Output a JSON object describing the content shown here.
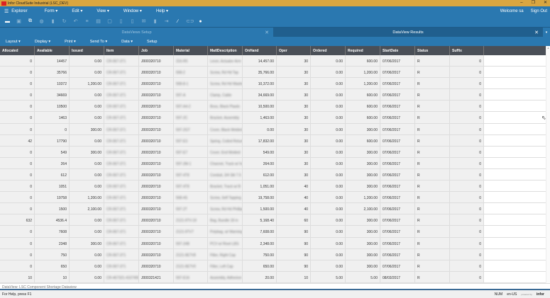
{
  "window": {
    "title": "Infor CloudSuite Industrial (LSC_DEV)",
    "minimize": "–",
    "restore": "❐",
    "close": "✕"
  },
  "menu": {
    "explorer": "Explorer",
    "items": [
      "Form ▾",
      "Edit ▾",
      "View ▾",
      "Window ▾",
      "Help ▾"
    ],
    "welcome": "Welcome sa",
    "signout": "Sign Out"
  },
  "toolbar": {
    "icons": [
      "open-folder-icon",
      "save-icon",
      "new-window-icon",
      "globe-icon",
      "delete-icon",
      "refresh-icon",
      "undo-icon",
      "filter-icon",
      "grid-icon",
      "clipboard-icon",
      "document-icon",
      "copy-icon",
      "mail-icon",
      "attach-icon",
      "export-icon",
      "pen-icon",
      "link-icon",
      "info-icon"
    ]
  },
  "tabs": [
    {
      "label": "DataViews Setup",
      "close": "✕"
    },
    {
      "label": "DataView Results",
      "close": "✕"
    }
  ],
  "tab_dropdown": "▾",
  "subbar": [
    "Layout ▾",
    "Display ▾",
    "Print ▾",
    "Send To ▾",
    "Data ▾",
    "Setup"
  ],
  "columns": [
    "Allocated",
    "Available",
    "Issued",
    "Item",
    "Job",
    "Material",
    "MatlDescription",
    "OnHand",
    "Oper",
    "Ordered",
    "Required",
    "StartDate",
    "Status",
    "Suffix"
  ],
  "rows": [
    [
      "0",
      "14457",
      "0.00",
      "CR-067-371",
      "J000320710",
      "316-R5",
      "Lever, Actuator Arm",
      "14,457.00",
      "30",
      "0.00",
      "600.00",
      "07/06/2017",
      "R",
      "0"
    ],
    [
      "0",
      "35766",
      "0.00",
      "CR-067-371",
      "J000320710",
      "568-2",
      "Screw, Rd Hd Tap",
      "35,766.00",
      "30",
      "0.00",
      "1,200.00",
      "07/06/2017",
      "R",
      "0"
    ],
    [
      "0",
      "10372",
      "1,200.00",
      "CR-067-371",
      "J000320710",
      "568-8-1",
      "Screw, Rd Hd Washer",
      "10,372.00",
      "30",
      "0.00",
      "1,200.00",
      "07/06/2017",
      "R",
      "0"
    ],
    [
      "0",
      "34669",
      "0.00",
      "CR-067-371",
      "J000320710",
      "597-A",
      "Clamp, Cable",
      "34,669.00",
      "30",
      "0.00",
      "600.00",
      "07/06/2017",
      "R",
      "0"
    ],
    [
      "0",
      "10500",
      "0.00",
      "CR-067-371",
      "J000320710",
      "597-A4-2",
      "Boss, Black Plastic",
      "10,500.00",
      "30",
      "0.00",
      "600.00",
      "07/06/2017",
      "R",
      "0"
    ],
    [
      "0",
      "1463",
      "0.00",
      "CR-067-371",
      "J000320710",
      "597-2C",
      "Bracket, Assembly",
      "1,463.00",
      "30",
      "0.00",
      "600.00",
      "07/06/2017",
      "R",
      "0"
    ],
    [
      "0",
      "0",
      "300.00",
      "CR-067-371",
      "J000320710",
      "597-2GT",
      "Cover, Black Molded",
      "0.00",
      "30",
      "0.00",
      "300.00",
      "07/06/2017",
      "R",
      "0"
    ],
    [
      "42",
      "17790",
      "0.00",
      "CR-067-371",
      "J000320710",
      "597-E3",
      "Spring, Coiled Return",
      "17,832.00",
      "30",
      "0.00",
      "600.00",
      "07/06/2017",
      "R",
      "0"
    ],
    [
      "0",
      "549",
      "300.00",
      "CR-067-371",
      "J000320710",
      "597-E7",
      "Cover, End Molded",
      "549.00",
      "30",
      "0.00",
      "300.00",
      "07/06/2017",
      "R",
      "0"
    ],
    [
      "0",
      "264",
      "0.00",
      "CR-067-371",
      "J000320710",
      "597-2M-1",
      "Channel, Track w/ Ins",
      "264.00",
      "30",
      "0.00",
      "300.00",
      "07/06/2017",
      "R",
      "0"
    ],
    [
      "0",
      "612",
      "0.00",
      "CR-067-371",
      "J000320710",
      "597-4T8",
      "Conduit, 3/4 Slit 7.5",
      "612.00",
      "30",
      "0.00",
      "300.00",
      "07/06/2017",
      "R",
      "0"
    ],
    [
      "0",
      "1051",
      "0.00",
      "CR-067-371",
      "J000320710",
      "597-4T8",
      "Bracket, Track w/ B",
      "1,051.00",
      "40",
      "0.00",
      "300.00",
      "07/06/2017",
      "R",
      "0"
    ],
    [
      "0",
      "19758",
      "1,200.00",
      "CR-067-371",
      "J000320710",
      "568-4S",
      "Screw, Self Tapping",
      "19,758.00",
      "40",
      "0.00",
      "1,200.00",
      "07/06/2017",
      "R",
      "0"
    ],
    [
      "0",
      "1500",
      "2,100.00",
      "CR-067-371",
      "J000320710",
      "597-2T",
      "Screw, Rd Hd Phillips",
      "1,500.00",
      "40",
      "0.00",
      "2,100.00",
      "07/06/2017",
      "R",
      "0"
    ],
    [
      "632",
      "4536.4",
      "0.00",
      "CR-067-371",
      "J000320710",
      "2121-9TV-19",
      "Bag, Bundle 18 in",
      "5,168.40",
      "60",
      "0.00",
      "300.00",
      "07/06/2017",
      "R",
      "0"
    ],
    [
      "0",
      "7608",
      "0.00",
      "CR-067-371",
      "J000320710",
      "2121-9TV7",
      "Polybag, w/ Warning",
      "7,608.00",
      "90",
      "0.00",
      "300.00",
      "07/06/2017",
      "R",
      "0"
    ],
    [
      "0",
      "2348",
      "300.00",
      "CR-067-371",
      "J000320710",
      "597-24B",
      "PCV w/ Rivet LBS",
      "2,348.00",
      "90",
      "0.00",
      "300.00",
      "07/06/2017",
      "R",
      "0"
    ],
    [
      "0",
      "750",
      "0.00",
      "CR-067-371",
      "J000320710",
      "2121-9E7V8",
      "Filter, Right Cap",
      "750.00",
      "90",
      "0.00",
      "300.00",
      "07/06/2017",
      "R",
      "0"
    ],
    [
      "0",
      "650",
      "0.00",
      "CR-067-371",
      "J000320710",
      "2121-9E7V0",
      "Filter, Left Cap",
      "650.00",
      "90",
      "0.00",
      "300.00",
      "07/06/2017",
      "R",
      "0"
    ],
    [
      "10",
      "10",
      "0.00",
      "CR-467321-4107455",
      "J000321421",
      "597-E16",
      "Assembly, Adhesive",
      "20.00",
      "10",
      "5.00",
      "5.00",
      "08/03/2017",
      "R",
      "0"
    ]
  ],
  "footer": "DataView: LSC Component Shortage Dataview",
  "status": {
    "help": "For Help, press F1",
    "num": "NUM",
    "locale": "en-US",
    "powered": "powered by",
    "brand": "infor"
  },
  "colors": {
    "titlebar": "#d9a640",
    "accent": "#2a78b0",
    "header": "#4a4f57"
  }
}
